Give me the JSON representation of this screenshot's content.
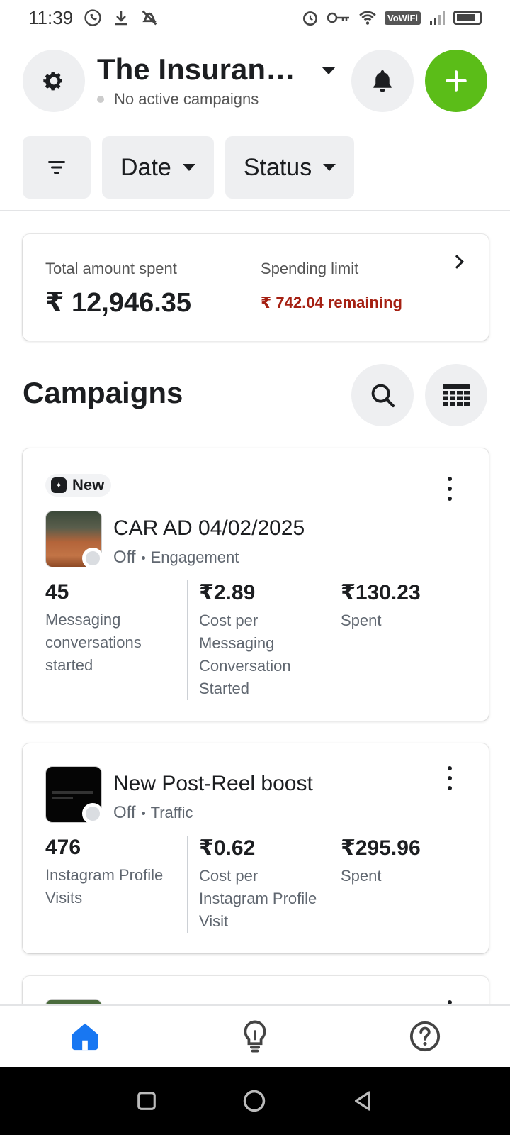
{
  "status_bar": {
    "time": "11:39",
    "vowifi": "VoWiFi"
  },
  "header": {
    "account_title": "The Insurance Guy",
    "account_status": "No active campaigns"
  },
  "filters": {
    "date_label": "Date",
    "status_label": "Status"
  },
  "summary": {
    "total_label": "Total amount spent",
    "total_value": "₹ 12,946.35",
    "limit_label": "Spending limit",
    "limit_remaining": "₹ 742.04 remaining"
  },
  "campaigns_section": {
    "title": "Campaigns"
  },
  "campaigns": [
    {
      "badge": "New",
      "name": "CAR AD 04/02/2025",
      "status": "Off",
      "objective": "Engagement",
      "metrics": [
        {
          "value": "45",
          "label": "Messaging conversations started"
        },
        {
          "value": "₹2.89",
          "label": "Cost per Messaging Conversation Started"
        },
        {
          "value": "₹130.23",
          "label": "Spent"
        }
      ]
    },
    {
      "name": "New Post-Reel boost",
      "status": "Off",
      "objective": "Traffic",
      "metrics": [
        {
          "value": "476",
          "label": "Instagram Profile Visits"
        },
        {
          "value": "₹0.62",
          "label": "Cost per Instagram Profile Visit"
        },
        {
          "value": "₹295.96",
          "label": "Spent"
        }
      ]
    }
  ],
  "bottom_nav": {
    "items": [
      "home-icon",
      "lightbulb-icon",
      "help-icon"
    ],
    "active_color": "#1877f2"
  },
  "colors": {
    "accent_green": "#5bbd18",
    "remaining_red": "#a52012",
    "chip_bg": "#eeeff1"
  }
}
